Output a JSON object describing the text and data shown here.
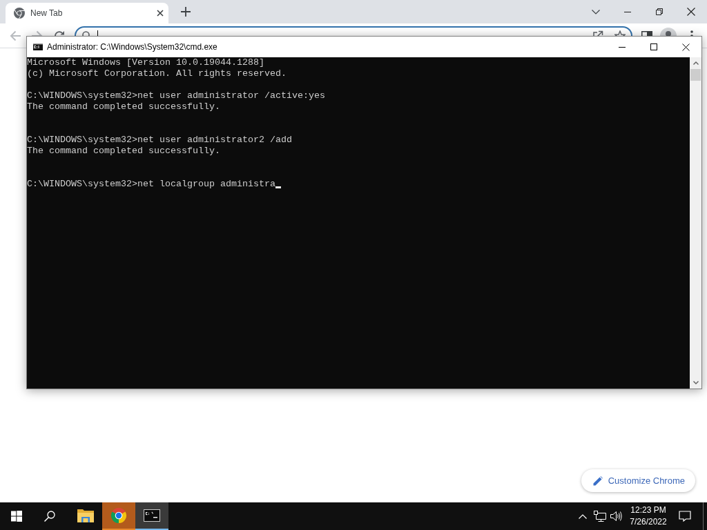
{
  "browser": {
    "tabs": [
      {
        "title": "New Tab",
        "selected": true
      }
    ],
    "nav_buttons": [
      {
        "kind": "back",
        "disabled": true
      },
      {
        "kind": "forward",
        "disabled": true
      },
      {
        "kind": "reload",
        "disabled": false
      }
    ],
    "address_bar": {
      "focused": true
    },
    "customize_button": {
      "label": "Customize Chrome"
    }
  },
  "console_window": {
    "title": "Administrator: C:\\Windows\\System32\\cmd.exe",
    "entries": [
      {
        "kind": "banner",
        "lines": [
          "Microsoft Windows [Version 10.0.19044.1288]",
          "(c) Microsoft Corporation. All rights reserved."
        ]
      },
      {
        "kind": "command",
        "lines": [
          "C:\\WINDOWS\\system32>net user administrator /active:yes",
          "The command completed successfully."
        ]
      },
      {
        "kind": "command",
        "lines": [
          "C:\\WINDOWS\\system32>net user administrator2 /add",
          "The command completed successfully."
        ]
      },
      {
        "kind": "input",
        "lines": [
          "C:\\WINDOWS\\system32>net localgroup administra"
        ]
      }
    ]
  },
  "taskbar": {
    "apps": [
      {
        "kind": "explorer",
        "active": false,
        "flashing": false
      },
      {
        "kind": "chrome",
        "active": false,
        "flashing": true
      },
      {
        "kind": "terminal",
        "active": true,
        "flashing": false
      }
    ],
    "clock": {
      "time": "12:23 PM",
      "date": "7/26/2022"
    }
  }
}
